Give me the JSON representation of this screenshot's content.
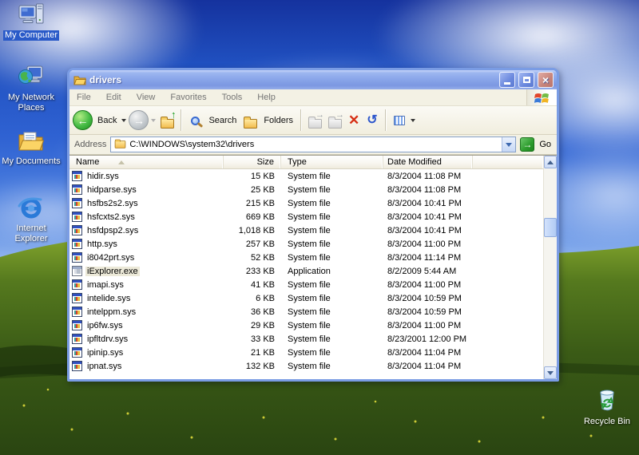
{
  "desktop": {
    "icons": [
      {
        "label": "My Computer",
        "selected": true
      },
      {
        "label": "My Network Places",
        "selected": false
      },
      {
        "label": "My Documents",
        "selected": false
      },
      {
        "label": "Internet Explorer",
        "selected": false
      },
      {
        "label": "Recycle Bin",
        "selected": false
      }
    ]
  },
  "window": {
    "title": "drivers",
    "menu": [
      "File",
      "Edit",
      "View",
      "Favorites",
      "Tools",
      "Help"
    ],
    "toolbar": {
      "back_label": "Back",
      "search_label": "Search",
      "folders_label": "Folders"
    },
    "address": {
      "label": "Address",
      "value": "C:\\WINDOWS\\system32\\drivers",
      "go_label": "Go"
    },
    "columns": [
      "Name",
      "Size",
      "Type",
      "Date Modified"
    ],
    "files": [
      {
        "name": "hidir.sys",
        "size": "15 KB",
        "type": "System file",
        "date": "8/3/2004 11:08 PM",
        "icon": "system",
        "selected": false
      },
      {
        "name": "hidparse.sys",
        "size": "25 KB",
        "type": "System file",
        "date": "8/3/2004 11:08 PM",
        "icon": "system",
        "selected": false
      },
      {
        "name": "hsfbs2s2.sys",
        "size": "215 KB",
        "type": "System file",
        "date": "8/3/2004 10:41 PM",
        "icon": "system",
        "selected": false
      },
      {
        "name": "hsfcxts2.sys",
        "size": "669 KB",
        "type": "System file",
        "date": "8/3/2004 10:41 PM",
        "icon": "system",
        "selected": false
      },
      {
        "name": "hsfdpsp2.sys",
        "size": "1,018 KB",
        "type": "System file",
        "date": "8/3/2004 10:41 PM",
        "icon": "system",
        "selected": false
      },
      {
        "name": "http.sys",
        "size": "257 KB",
        "type": "System file",
        "date": "8/3/2004 11:00 PM",
        "icon": "system",
        "selected": false
      },
      {
        "name": "i8042prt.sys",
        "size": "52 KB",
        "type": "System file",
        "date": "8/3/2004 11:14 PM",
        "icon": "system",
        "selected": false
      },
      {
        "name": "iExplorer.exe",
        "size": "233 KB",
        "type": "Application",
        "date": "8/2/2009 5:44 AM",
        "icon": "application",
        "selected": true
      },
      {
        "name": "imapi.sys",
        "size": "41 KB",
        "type": "System file",
        "date": "8/3/2004 11:00 PM",
        "icon": "system",
        "selected": false
      },
      {
        "name": "intelide.sys",
        "size": "6 KB",
        "type": "System file",
        "date": "8/3/2004 10:59 PM",
        "icon": "system",
        "selected": false
      },
      {
        "name": "intelppm.sys",
        "size": "36 KB",
        "type": "System file",
        "date": "8/3/2004 10:59 PM",
        "icon": "system",
        "selected": false
      },
      {
        "name": "ip6fw.sys",
        "size": "29 KB",
        "type": "System file",
        "date": "8/3/2004 11:00 PM",
        "icon": "system",
        "selected": false
      },
      {
        "name": "ipfltdrv.sys",
        "size": "33 KB",
        "type": "System file",
        "date": "8/23/2001 12:00 PM",
        "icon": "system",
        "selected": false
      },
      {
        "name": "ipinip.sys",
        "size": "21 KB",
        "type": "System file",
        "date": "8/3/2004 11:04 PM",
        "icon": "system",
        "selected": false
      },
      {
        "name": "ipnat.sys",
        "size": "132 KB",
        "type": "System file",
        "date": "8/3/2004 11:04 PM",
        "icon": "system",
        "selected": false
      }
    ]
  },
  "colors": {
    "selection_blue": "#2a5ac8",
    "titlebar_blue": "#8aa6ea",
    "go_green": "#2d9c2d",
    "delete_red": "#d62e14",
    "inactive_highlight": "#ece9d8"
  }
}
